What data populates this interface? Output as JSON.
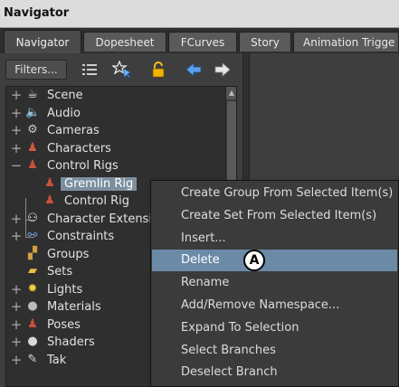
{
  "window": {
    "title": "Navigator"
  },
  "tabs": [
    {
      "label": "Navigator",
      "active": true
    },
    {
      "label": "Dopesheet"
    },
    {
      "label": "FCurves"
    },
    {
      "label": "Story"
    },
    {
      "label": "Animation Trigge"
    }
  ],
  "toolbar": {
    "filters_label": "Filters...",
    "tools": [
      "list-view-icon",
      "star-pointer-icon",
      "padlock-icon",
      "arrow-left-icon",
      "arrow-right-icon"
    ]
  },
  "tree": {
    "items": [
      {
        "label": "Scene",
        "icon": "teapot-icon",
        "expander": "+"
      },
      {
        "label": "Audio",
        "icon": "speaker-icon",
        "expander": "+"
      },
      {
        "label": "Cameras",
        "icon": "camera-icon",
        "expander": "+"
      },
      {
        "label": "Characters",
        "icon": "character-icon",
        "expander": "+"
      },
      {
        "label": "Control Rigs",
        "icon": "control-rig-icon",
        "expander": "−"
      },
      {
        "label": "Gremlin Rig",
        "icon": "rig-icon",
        "selected": true
      },
      {
        "label": "Control Rig",
        "icon": "rig-icon"
      },
      {
        "label": "Character Extensio",
        "icon": "character-extension-icon",
        "expander": "+"
      },
      {
        "label": "Constraints",
        "icon": "constraint-icon",
        "expander": "+"
      },
      {
        "label": "Groups",
        "icon": "group-icon"
      },
      {
        "label": "Sets",
        "icon": "folder-icon"
      },
      {
        "label": "Lights",
        "icon": "light-icon",
        "expander": "+"
      },
      {
        "label": "Materials",
        "icon": "material-icon",
        "expander": "+"
      },
      {
        "label": "Poses",
        "icon": "pose-icon",
        "expander": "+"
      },
      {
        "label": "Shaders",
        "icon": "shader-icon",
        "expander": "+"
      },
      {
        "label": "Tak",
        "icon": "take-icon",
        "expander": "+"
      }
    ]
  },
  "context_menu": {
    "items": [
      {
        "label": "Create Group From Selected Item(s)"
      },
      {
        "label": "Create Set From Selected Item(s)"
      },
      {
        "label": "Insert..."
      },
      {
        "label": "Delete",
        "highlighted": true
      },
      {
        "label": "Rename"
      },
      {
        "label": "Add/Remove Namespace..."
      },
      {
        "label": "Expand To Selection"
      },
      {
        "label": "Select Branches"
      },
      {
        "label": "Deselect Branch"
      }
    ]
  },
  "callout": {
    "label": "A"
  },
  "colors": {
    "menu_highlight": "#6b8aa6",
    "selection": "#7b8f9e",
    "panel": "#3e3e3e"
  }
}
